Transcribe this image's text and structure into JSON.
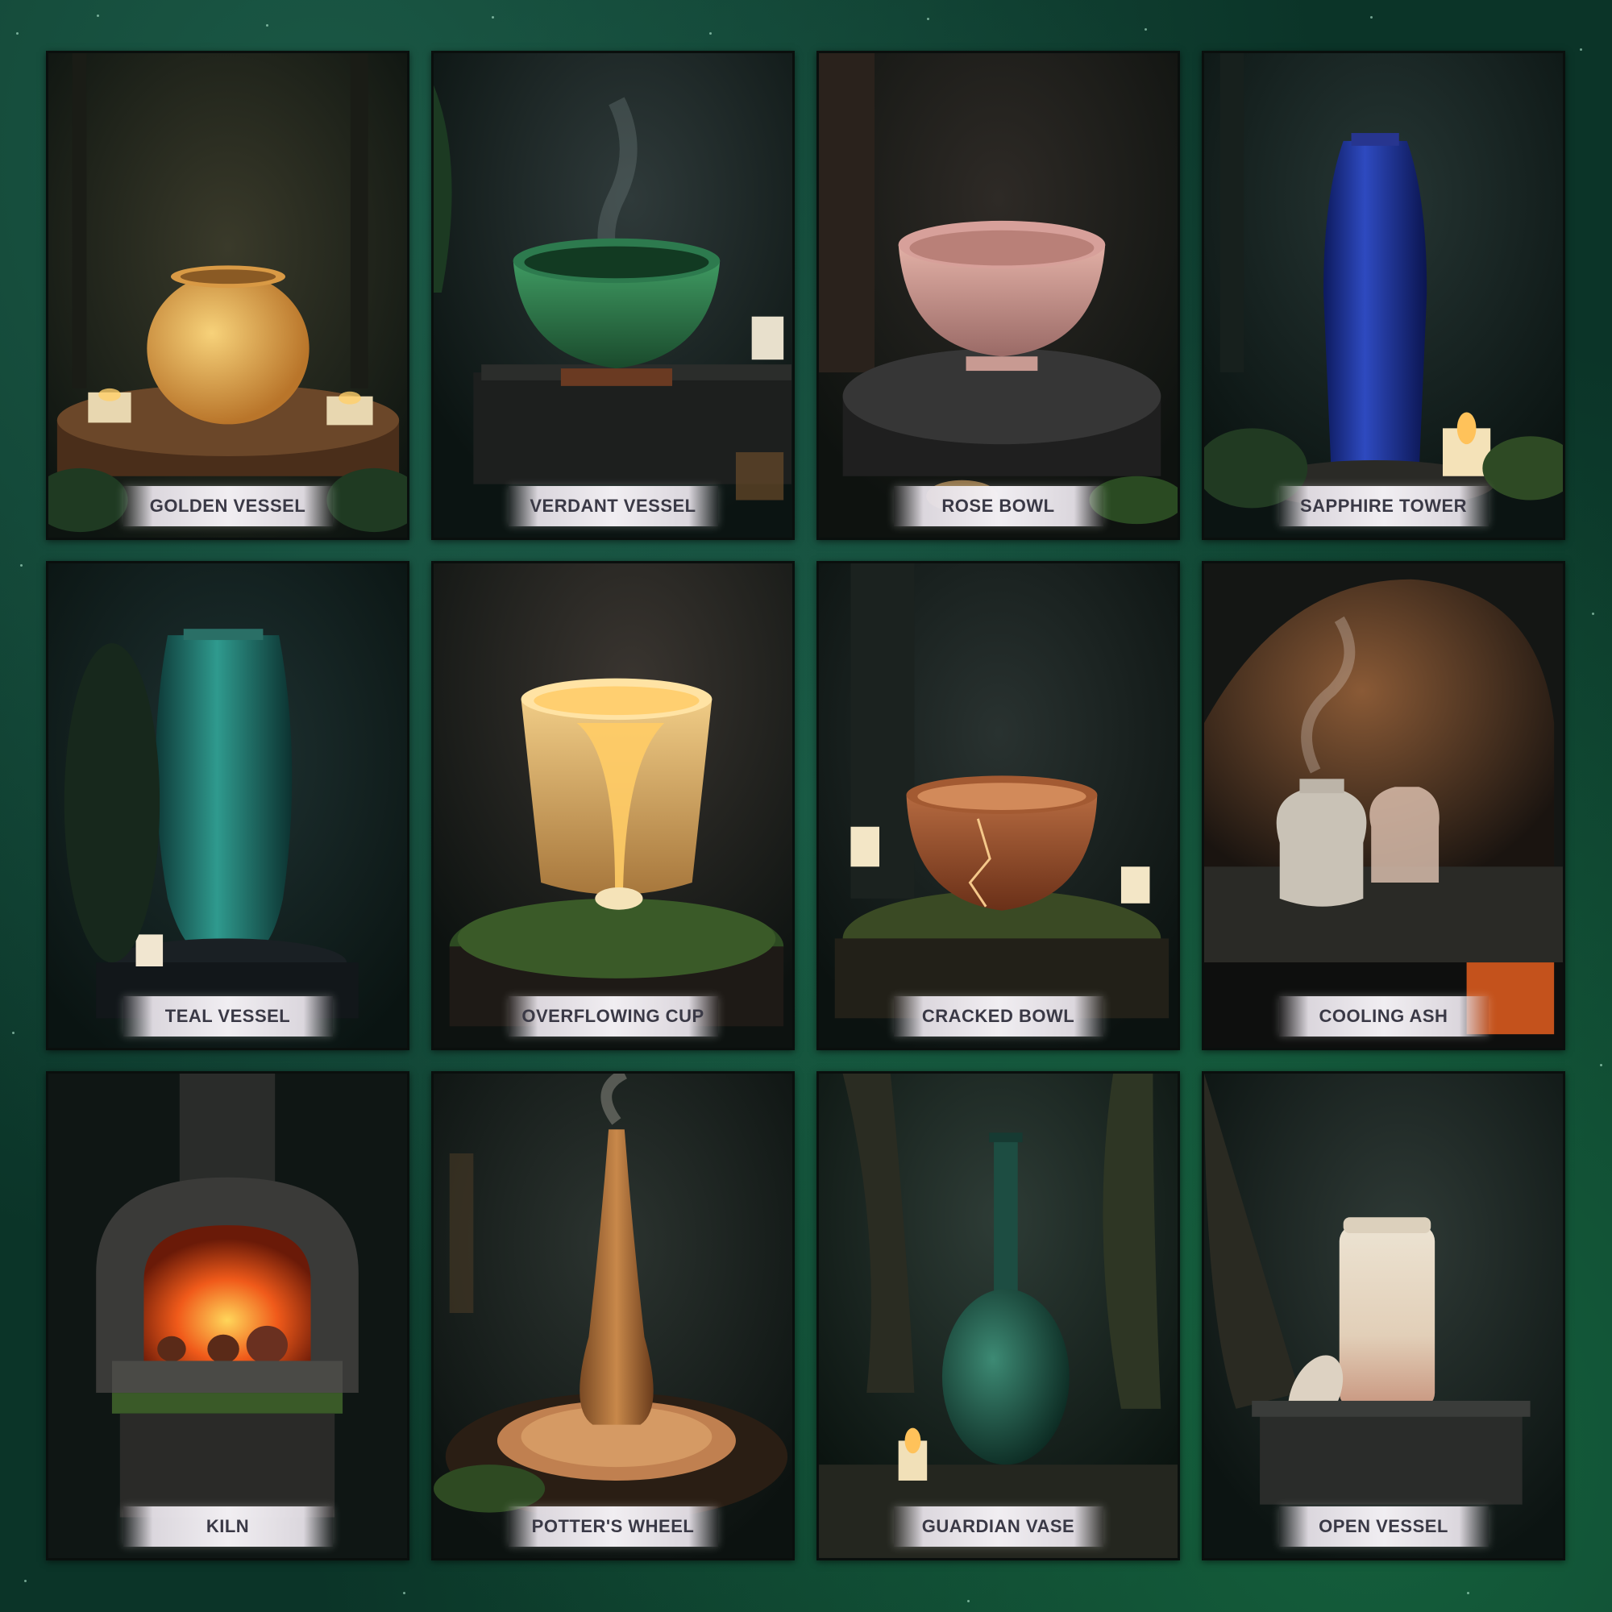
{
  "gallery": {
    "cards": [
      {
        "label": "GOLDEN VESSEL",
        "object": "golden-round-vessel",
        "color": "#d9a24a"
      },
      {
        "label": "VERDANT VESSEL",
        "object": "green-bowl",
        "color": "#2f7a4e"
      },
      {
        "label": "ROSE BOWL",
        "object": "pink-bowl",
        "color": "#c9958f"
      },
      {
        "label": "SAPPHIRE TOWER",
        "object": "blue-tall-vase",
        "color": "#1c2f8f"
      },
      {
        "label": "TEAL VESSEL",
        "object": "teal-tall-vase",
        "color": "#1f6e66"
      },
      {
        "label": "OVERFLOWING CUP",
        "object": "glowing-cup",
        "color": "#e0b368"
      },
      {
        "label": "CRACKED BOWL",
        "object": "cracked-clay-bowl",
        "color": "#9c5232"
      },
      {
        "label": "COOLING ASH",
        "object": "ash-pots-in-oven",
        "color": "#c7a88e"
      },
      {
        "label": "KILN",
        "object": "brick-kiln-fire",
        "color": "#e2561c"
      },
      {
        "label": "POTTER'S WHEEL",
        "object": "clay-on-wheel",
        "color": "#b97c45"
      },
      {
        "label": "GUARDIAN VASE",
        "object": "green-bottle-vase",
        "color": "#1d4d42"
      },
      {
        "label": "OPEN VESSEL",
        "object": "cracked-white-jar",
        "color": "#e6d9c6"
      }
    ]
  }
}
